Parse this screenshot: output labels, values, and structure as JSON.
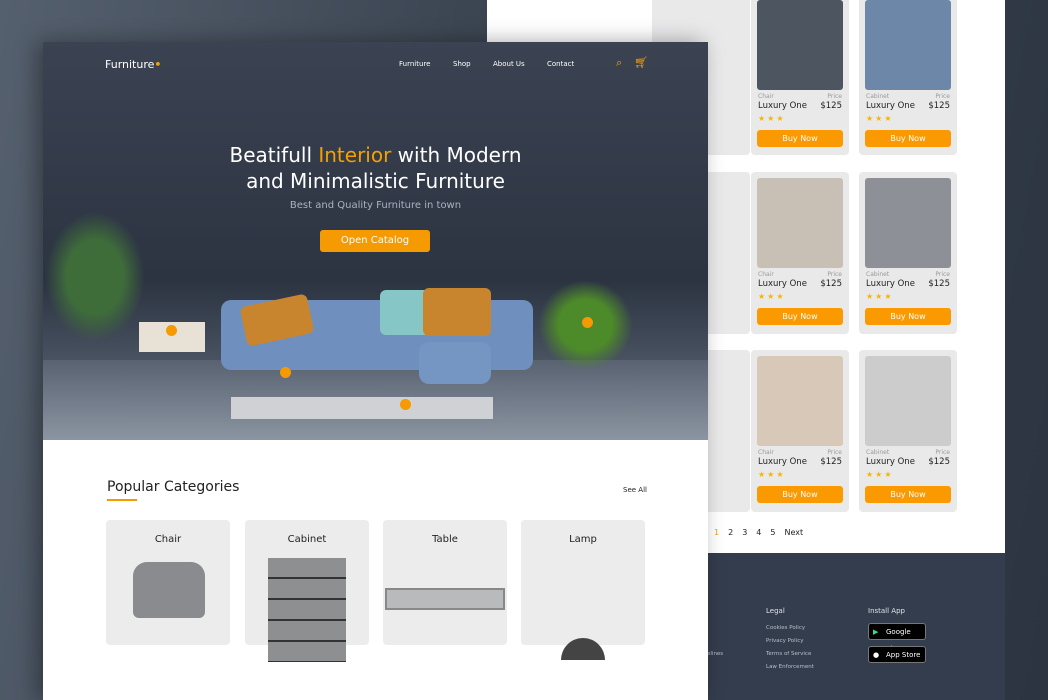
{
  "brand": {
    "name": "Furniture",
    "accent": "#f59a00"
  },
  "nav": {
    "items": [
      "Furniture",
      "Shop",
      "About Us",
      "Contact"
    ]
  },
  "hero": {
    "title_pre": "Beatifull ",
    "title_highlight": "Interior",
    "title_post": " with Modern",
    "title_line2": "and Minimalistic Furniture",
    "subtitle": "Best and Quality Furniture in town",
    "cta": "Open Catalog"
  },
  "categories": {
    "heading": "Popular Categories",
    "see_all": "See All",
    "items": [
      "Chair",
      "Cabinet",
      "Table",
      "Lamp"
    ]
  },
  "products": [
    {
      "category": "Chair",
      "price_label": "Price",
      "name": "Luxury One",
      "price": "$125",
      "rating": 3,
      "button": "Buy Now"
    },
    {
      "category": "Cabinet",
      "price_label": "Price",
      "name": "Luxury One",
      "price": "$125",
      "rating": 3,
      "button": "Buy Now"
    },
    {
      "category": "Chair",
      "price_label": "Price",
      "name": "Luxury One",
      "price": "$125",
      "rating": 3,
      "button": "Buy Now"
    },
    {
      "category": "Cabinet",
      "price_label": "Price",
      "name": "Luxury One",
      "price": "$125",
      "rating": 3,
      "button": "Buy Now"
    },
    {
      "category": "Chair",
      "price_label": "Price",
      "name": "Luxury One",
      "price": "$125",
      "rating": 3,
      "button": "Buy Now"
    },
    {
      "category": "Cabinet",
      "price_label": "Price",
      "name": "Luxury One",
      "price": "$125",
      "rating": 3,
      "button": "Buy Now"
    }
  ],
  "pagination": {
    "pages": [
      "1",
      "2",
      "3",
      "4",
      "5"
    ],
    "current": "1",
    "next": "Next"
  },
  "footer": {
    "legal_heading": "Legal",
    "legal_links": [
      "Cookies Policy",
      "Privacy Policy",
      "Terms of Service",
      "Law Enforcement"
    ],
    "partial_link": "elines",
    "app_heading": "Install App",
    "google_play": "Google Play",
    "app_store": "App Store"
  }
}
